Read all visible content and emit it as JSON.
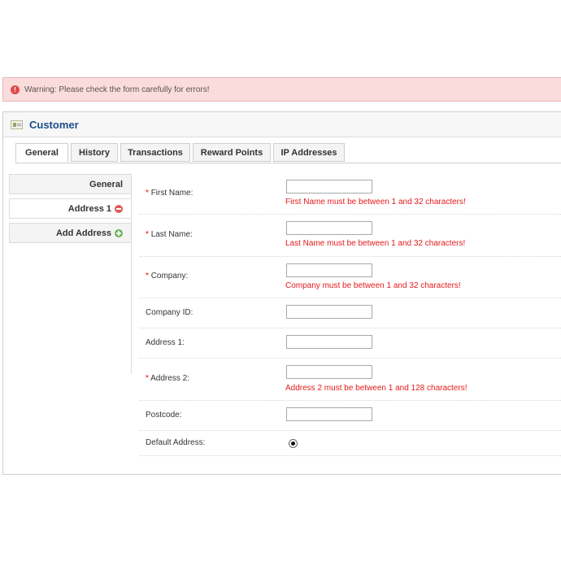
{
  "warning": {
    "icon": "exclamation-icon",
    "text": "Warning: Please check the form carefully for errors!"
  },
  "panel": {
    "icon": "customer-card-icon",
    "title": "Customer"
  },
  "tabs": [
    {
      "label": "General",
      "active": true
    },
    {
      "label": "History",
      "active": false
    },
    {
      "label": "Transactions",
      "active": false
    },
    {
      "label": "Reward Points",
      "active": false
    },
    {
      "label": "IP Addresses",
      "active": false
    }
  ],
  "side_tabs": [
    {
      "label": "General",
      "icon": null
    },
    {
      "label": "Address 1",
      "icon": "remove-icon",
      "active": true
    },
    {
      "label": "Add Address",
      "icon": "add-icon"
    }
  ],
  "form": {
    "required_mark": "*",
    "fields": [
      {
        "label": "First Name:",
        "required": true,
        "value": "",
        "error": "First Name must be between 1 and 32 characters!"
      },
      {
        "label": "Last Name:",
        "required": true,
        "value": "",
        "error": "Last Name must be between 1 and 32 characters!"
      },
      {
        "label": "Company:",
        "required": true,
        "value": "",
        "error": "Company must be between 1 and 32 characters!"
      },
      {
        "label": "Company ID:",
        "required": false,
        "value": "",
        "error": ""
      },
      {
        "label": "Address 1:",
        "required": false,
        "value": "",
        "error": ""
      },
      {
        "label": "Address 2:",
        "required": true,
        "value": "",
        "error": "Address 2 must be between 1 and 128 characters!"
      },
      {
        "label": "Postcode:",
        "required": false,
        "value": "",
        "error": ""
      }
    ],
    "default_address": {
      "label": "Default Address:",
      "checked": true
    }
  },
  "colors": {
    "warning_bg": "#fbdcdc",
    "title": "#1d4e89",
    "error": "#e51a1a"
  }
}
